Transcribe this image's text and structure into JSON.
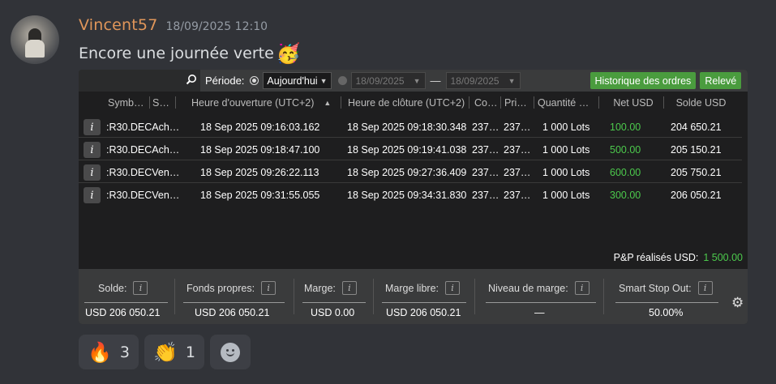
{
  "message": {
    "username": "Vincent57",
    "timestamp": "18/09/2025 12:10",
    "text": "Encore une journée verte",
    "emoji": "🥳"
  },
  "toolbar": {
    "period_label": "Période:",
    "period_selected": "Aujourd'hui",
    "date_from": "18/09/2025",
    "date_to": "18/09/2025",
    "range_separator": "—",
    "order_history_label": "Historique des ordres",
    "statement_label": "Relevé"
  },
  "table": {
    "columns": [
      "Symb…",
      "S…",
      "Heure d'ouverture (UTC+2)",
      "Heure de clôture (UTC+2)",
      "Co…",
      "Pri…",
      "Quantité …",
      "Net USD",
      "Solde USD"
    ],
    "sort_indicator": "▲",
    "rows": [
      {
        "symbol": ":R30.DECAch…",
        "open": "18 Sep 2025 09:16:03.162",
        "close": "18 Sep 2025 09:18:30.348",
        "co": "237…",
        "pri": "237…",
        "qty": "1 000 Lots",
        "net": "100.00",
        "balance": "204 650.21"
      },
      {
        "symbol": ":R30.DECAch…",
        "open": "18 Sep 2025 09:18:47.100",
        "close": "18 Sep 2025 09:19:41.038",
        "co": "237…",
        "pri": "237…",
        "qty": "1 000 Lots",
        "net": "500.00",
        "balance": "205 150.21"
      },
      {
        "symbol": ":R30.DECVen…",
        "open": "18 Sep 2025 09:26:22.113",
        "close": "18 Sep 2025 09:27:36.409",
        "co": "237…",
        "pri": "237…",
        "qty": "1 000 Lots",
        "net": "600.00",
        "balance": "205 750.21"
      },
      {
        "symbol": ":R30.DECVen…",
        "open": "18 Sep 2025 09:31:55.055",
        "close": "18 Sep 2025 09:34:31.830",
        "co": "237…",
        "pri": "237…",
        "qty": "1 000 Lots",
        "net": "300.00",
        "balance": "206 050.21"
      }
    ],
    "realized_label": "P&P réalisés USD:",
    "realized_value": "1 500.00"
  },
  "footer": {
    "metrics": [
      {
        "label": "Solde:",
        "value": "USD 206 050.21"
      },
      {
        "label": "Fonds propres:",
        "value": "USD 206 050.21"
      },
      {
        "label": "Marge:",
        "value": "USD 0.00"
      },
      {
        "label": "Marge libre:",
        "value": "USD 206 050.21"
      },
      {
        "label": "Niveau de marge:",
        "value": "—"
      },
      {
        "label": "Smart Stop Out:",
        "value": "50.00%"
      }
    ]
  },
  "reactions": [
    {
      "emoji": "🔥",
      "count": "3"
    },
    {
      "emoji": "👏",
      "count": "1"
    }
  ],
  "colors": {
    "username": "#e0965a",
    "profit_green": "#4cc94c",
    "button_green": "#4a9c3e"
  },
  "icons": {
    "search": "search-icon",
    "settings": "gear-icon",
    "info": "info-icon",
    "add_reaction": "add-reaction-icon"
  }
}
